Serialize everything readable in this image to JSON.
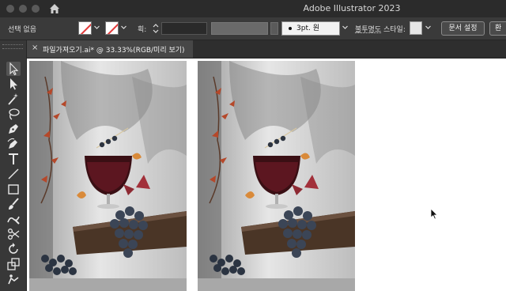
{
  "window": {
    "title": "Adobe Illustrator 2023",
    "traffic_lights": [
      "close",
      "minimize",
      "zoom"
    ],
    "home_icon": "home-icon"
  },
  "control_bar": {
    "selection_status": "선택 없음",
    "stroke_label": "획:",
    "brush_value": "3pt. 원",
    "opacity_label": "불투명도",
    "style_label": "스타일:",
    "document_setup_button": "문서 설정",
    "environment_button": "환"
  },
  "toolbar": {
    "tools": [
      "selection-tool-icon",
      "direct-selection-tool-icon",
      "magic-wand-tool-icon",
      "lasso-tool-icon",
      "pen-tool-icon",
      "curvature-tool-icon",
      "type-tool-icon",
      "line-segment-tool-icon",
      "rectangle-tool-icon",
      "paintbrush-tool-icon",
      "shaper-tool-icon",
      "scissors-tool-icon",
      "rotate-tool-icon",
      "scale-tool-icon",
      "puppet-warp-tool-icon"
    ]
  },
  "document_tab": {
    "close_glyph": "×",
    "name": "파일가져오기.ai* @ 33.33%(RGB/미리 보기)"
  },
  "canvas": {
    "artboards": [
      "artboard-1",
      "artboard-2"
    ],
    "image_subject": "still life: glass of red wine, grapes on wooden board, autumn leaves, leaf shadows"
  },
  "colors": {
    "ui_dark": "#2b2b2b",
    "ui_panel": "#3a3a3a",
    "stroke_none_red": "#e23a3a",
    "canvas": "#ffffff"
  }
}
